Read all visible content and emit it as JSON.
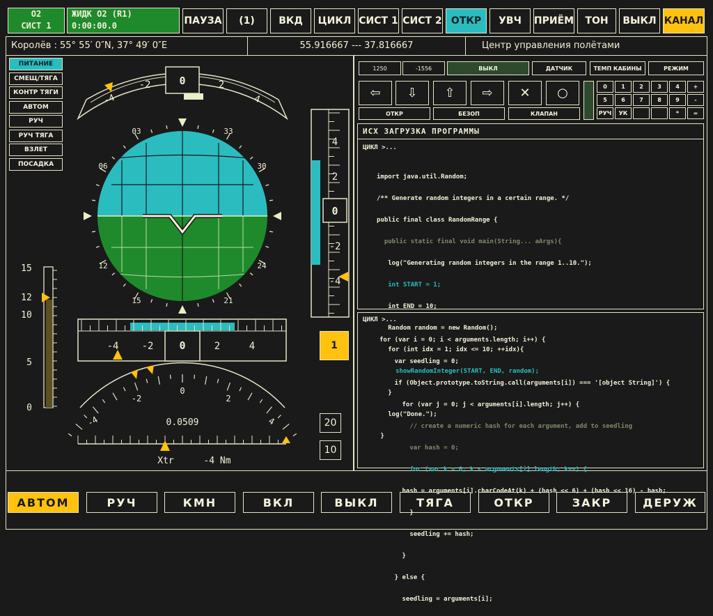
{
  "status": {
    "line1": "О2",
    "line2": "СИСТ 1",
    "mode": "ЖИДК О2 (R1)",
    "timer": "0:00:00.0"
  },
  "top_buttons": [
    "ПАУЗА",
    "(1)",
    "ВКД",
    "ЦИКЛ",
    "СИСТ 1",
    "СИСТ 2",
    "ОТКР",
    "УВЧ",
    "ПРИЁМ",
    "ТОН",
    "ВЫКЛ",
    "КАНАЛ"
  ],
  "info_bar": {
    "location": "Королёв : 55° 55′ 0″N, 37° 49′ 0″E",
    "coords": "55.916667 --- 37.816667",
    "center": "Центр управления полётами"
  },
  "left_menu": [
    "ПИТАНИЕ",
    "СМЕЩ/ТЯГА",
    "КОНТР ТЯГИ",
    "АВТОМ",
    "РУЧ",
    "РУЧ ТЯГА",
    "ВЗЛЕТ",
    "ПОСАДКА"
  ],
  "heading_tape": {
    "center": "0",
    "left": "-2",
    "right": "2",
    "far_left": "-4",
    "far_right": "4"
  },
  "attitude": {
    "labels": [
      "03",
      "33",
      "06",
      "30",
      "12",
      "24",
      "15",
      "21"
    ]
  },
  "vert_tape": {
    "labels": [
      "4",
      "2",
      "0",
      "-2",
      "-4"
    ]
  },
  "left_gauge": {
    "labels": [
      "15",
      "12",
      "10",
      "5",
      "0"
    ]
  },
  "horiz_tape": {
    "labels": [
      "-4",
      "-2",
      "0",
      "2",
      "4"
    ]
  },
  "arc_gauge": {
    "labels": [
      "-4",
      "-2",
      "0",
      "2",
      "4"
    ],
    "value": "0.0509"
  },
  "bottom_scale": {
    "label": "Xtr",
    "value": "-4 Nm"
  },
  "side_boxes": {
    "yellow": "1",
    "box20": "20",
    "box10": "10"
  },
  "controls": {
    "v1": "1250",
    "v2": "-1556",
    "off": "ВЫКЛ",
    "sensor": "ДАТЧИК",
    "cabin": "ТЕМП КАБИНЫ",
    "mode": "РЕЖИМ",
    "open": "ОТКР",
    "safe": "БЕЗОП",
    "valve": "КЛАПАН"
  },
  "keypad": [
    "0",
    "1",
    "2",
    "3",
    "4",
    "+",
    "5",
    "6",
    "7",
    "8",
    "9",
    "-",
    "РУЧ",
    "УК",
    "",
    "",
    "*",
    "="
  ],
  "program": {
    "title": "ИСХ ЗАГРУЗКА ПРОГРАММЫ",
    "prompt": "ЦИКЛ >...",
    "lines": [
      "import java.util.Random;",
      "/** Generate random integers in a certain range. */",
      "public final class RandomRange {",
      "  public static final void main(String... aArgs){",
      "   log(\"Generating random integers in the range 1..10.\");",
      "   int START = 1;",
      "   int END = 10;",
      "   Random random = new Random();",
      "   for (int idx = 1; idx <= 10; ++idx){",
      "     showRandomInteger(START, END, random);",
      "   }",
      "   log(\"Done.\");",
      " }"
    ]
  },
  "console": {
    "prompt": "ЦИКЛ >...",
    "lines": [
      "for (var i = 0; i < arguments.length; i++) {",
      "    var seedling = 0;",
      "    if (Object.prototype.toString.call(arguments[i]) === '[object String]') {",
      "      for (var j = 0; j < arguments[i].length; j++) {",
      "        // create a numeric hash for each argument, add to seedling",
      "        var hash = 0;",
      "        for (var k = 0; k < arguments[i].length; k++) {",
      "      hash = arguments[i].charCodeAt(k) + (hash << 6) + (hash << 16) - hash;",
      "        }",
      "        seedling += hash;",
      "      }",
      "    } else {",
      "      seedling = arguments[i];"
    ]
  },
  "bottom_buttons": [
    "АВТОМ",
    "РУЧ",
    "КМН",
    "ВКЛ",
    "ВЫКЛ",
    "ТЯГА",
    "ОТКР",
    "ЗАКР",
    "ДЕРУЖ"
  ]
}
